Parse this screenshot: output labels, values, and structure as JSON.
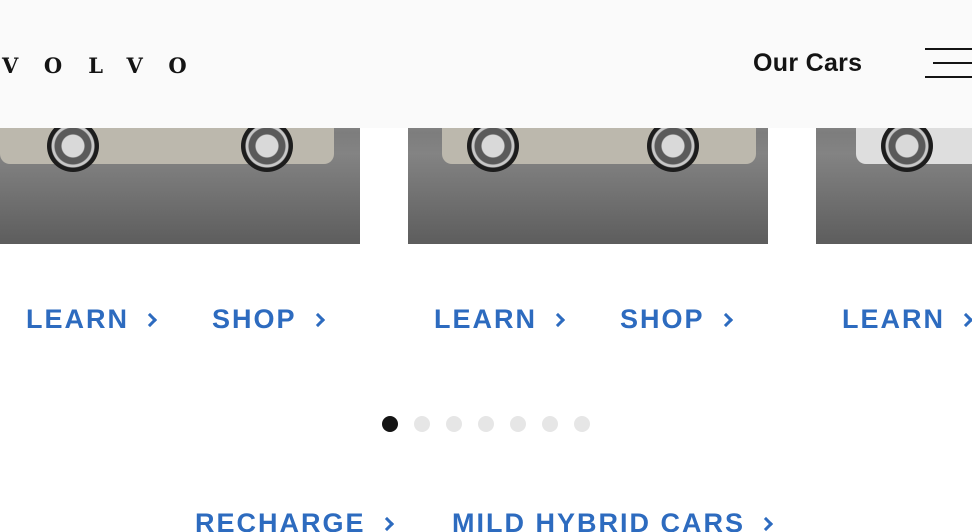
{
  "header": {
    "logo": "VOLVO",
    "nav_link": "Our Cars",
    "menu_icon": "hamburger-menu-icon"
  },
  "cards": [
    {
      "learn_label": "LEARN",
      "shop_label": "SHOP"
    },
    {
      "learn_label": "LEARN",
      "shop_label": "SHOP"
    },
    {
      "learn_label": "LEARN"
    }
  ],
  "carousel": {
    "slide_count": 7,
    "active_index": 0
  },
  "category_links": {
    "recharge": "RECHARGE",
    "mild_hybrid": "MILD HYBRID CARS"
  },
  "colors": {
    "accent": "#2d6bbf",
    "text": "#141414",
    "header_bg": "#fafafa",
    "dot_inactive": "#e6e6e6"
  }
}
